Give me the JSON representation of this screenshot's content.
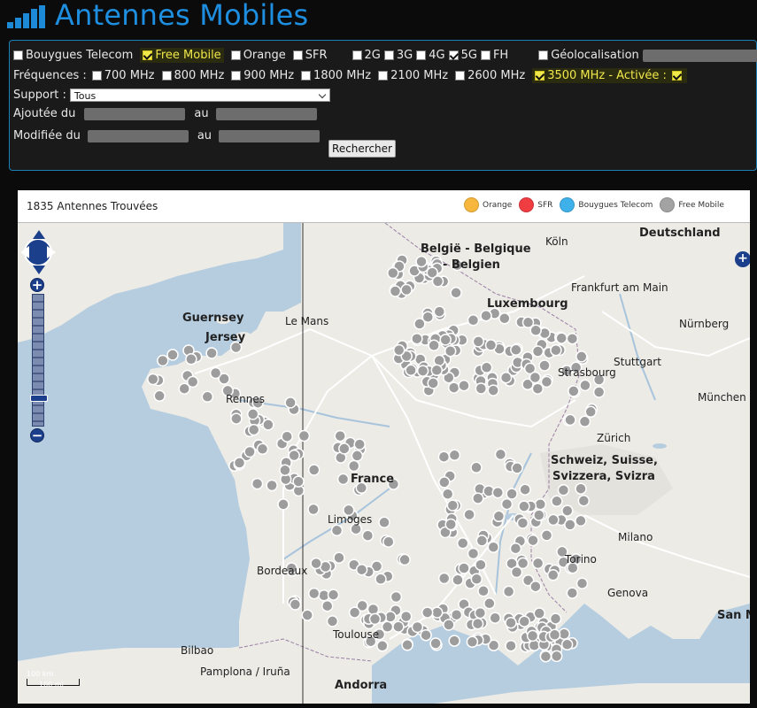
{
  "app": {
    "title": "Antennes Mobiles"
  },
  "filters": {
    "operators": [
      {
        "label": "Bouygues Telecom",
        "checked": false,
        "highlight": false
      },
      {
        "label": "Free Mobile",
        "checked": true,
        "highlight": true
      },
      {
        "label": "Orange",
        "checked": false,
        "highlight": false
      },
      {
        "label": "SFR",
        "checked": false,
        "highlight": false
      }
    ],
    "technologies": [
      {
        "label": "2G",
        "checked": false
      },
      {
        "label": "3G",
        "checked": false
      },
      {
        "label": "4G",
        "checked": false
      },
      {
        "label": "5G",
        "checked": true
      },
      {
        "label": "FH",
        "checked": false
      }
    ],
    "geolocation": {
      "label": "Géolocalisation",
      "checked": false
    },
    "frequencies_label": "Fréquences :",
    "frequencies": [
      {
        "label": "700 MHz",
        "checked": false
      },
      {
        "label": "800 MHz",
        "checked": false
      },
      {
        "label": "900 MHz",
        "checked": false
      },
      {
        "label": "1800 MHz",
        "checked": false
      },
      {
        "label": "2100 MHz",
        "checked": false
      },
      {
        "label": "2600 MHz",
        "checked": false
      },
      {
        "label": "3500 MHz - Activée :",
        "checked": true,
        "highlight": true
      }
    ],
    "support_label": "Support :",
    "support_value": "Tous",
    "added_label": "Ajoutée du",
    "modified_label": "Modifiée du",
    "to_label": "au",
    "search_button": "Rechercher"
  },
  "results": {
    "count_text": "1835 Antennes Trouvées",
    "legend": [
      {
        "name": "Orange",
        "color": "#f6b73c"
      },
      {
        "name": "SFR",
        "color": "#ef3d42"
      },
      {
        "name": "Bouygues Telecom",
        "color": "#3fb1ea"
      },
      {
        "name": "Free Mobile",
        "color": "#a3a3a3"
      }
    ]
  },
  "map": {
    "labels": {
      "deutschland": "Deutschland",
      "belgique": "België - Belgique",
      "belgien": "- Belgien",
      "koln": "Köln",
      "luxembourg": "Luxembourg",
      "frankfurt": "Frankfurt am Main",
      "nurnberg": "Nürnberg",
      "stuttgart": "Stuttgart",
      "munchen": "München",
      "strasbourg": "Strasbourg",
      "zurich": "Zürich",
      "schweiz": "Schweiz, Suisse,",
      "svizzera": "Svizzera, Svizra",
      "milano": "Milano",
      "torino": "Torino",
      "genova": "Genova",
      "sanm": "San M",
      "france": "France",
      "guernsey": "Guernsey",
      "jersey": "Jersey",
      "rennes": "Rennes",
      "limoges": "Limoges",
      "bordeaux": "Bordeaux",
      "toulouse": "Toulouse",
      "bilbao": "Bilbao",
      "pamplona": "Pamplona / Iruña",
      "andorra": "Andorra",
      "lemans": "Le Mans"
    },
    "scale": {
      "top": "100 km",
      "bottom": "100 mi"
    }
  }
}
